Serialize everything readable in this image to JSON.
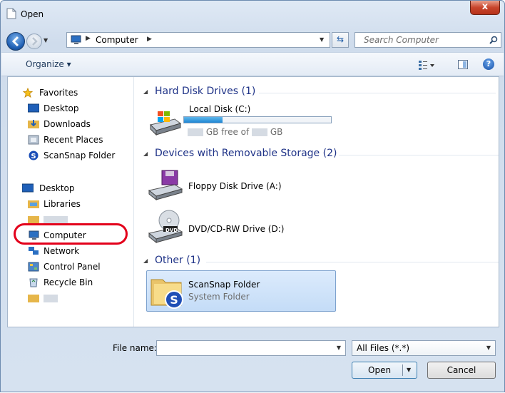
{
  "window": {
    "title": "Open",
    "close_label": "x"
  },
  "nav": {
    "address_label": "Computer",
    "search_placeholder": "Search Computer"
  },
  "toolbar": {
    "organize_label": "Organize ▾"
  },
  "sidebar": {
    "favorites": [
      {
        "label": "Favorites",
        "icon": "star-icon"
      },
      {
        "label": "Desktop",
        "icon": "desktop-icon"
      },
      {
        "label": "Downloads",
        "icon": "downloads-icon"
      },
      {
        "label": "Recent Places",
        "icon": "recent-places-icon"
      },
      {
        "label": "ScanSnap Folder",
        "icon": "scansnap-icon"
      }
    ],
    "tree": [
      {
        "label": "Desktop",
        "icon": "desktop-icon"
      },
      {
        "label": "Libraries",
        "icon": "libraries-icon"
      },
      {
        "label": "",
        "icon": "user-folder-icon"
      },
      {
        "label": "Computer",
        "icon": "computer-icon"
      },
      {
        "label": "Network",
        "icon": "network-icon"
      },
      {
        "label": "Control Panel",
        "icon": "control-panel-icon"
      },
      {
        "label": "Recycle Bin",
        "icon": "recycle-bin-icon"
      },
      {
        "label": "",
        "icon": "folder-icon"
      }
    ]
  },
  "main": {
    "groups": [
      {
        "label": "Hard Disk Drives (1)"
      },
      {
        "label": "Devices with Removable Storage (2)"
      },
      {
        "label": "Other (1)"
      }
    ],
    "local_disk": {
      "label": "Local Disk (C:)",
      "free_prefix": "GB free of",
      "free_suffix": "GB",
      "used_fraction": 0.26
    },
    "floppy": {
      "label": "Floppy Disk Drive (A:)"
    },
    "dvd": {
      "label": "DVD/CD-RW Drive (D:)",
      "badge": "DVD"
    },
    "scansnap": {
      "label": "ScanSnap Folder",
      "sublabel": "System Folder"
    }
  },
  "footer": {
    "file_name_label": "File name:",
    "file_name_value": "",
    "filter_value": "All Files (*.*)",
    "open_label": "Open",
    "cancel_label": "Cancel"
  },
  "colors": {
    "highlight_ring": "#e3001b",
    "selection": "#c4dcf7",
    "group_header": "#1e3287"
  }
}
